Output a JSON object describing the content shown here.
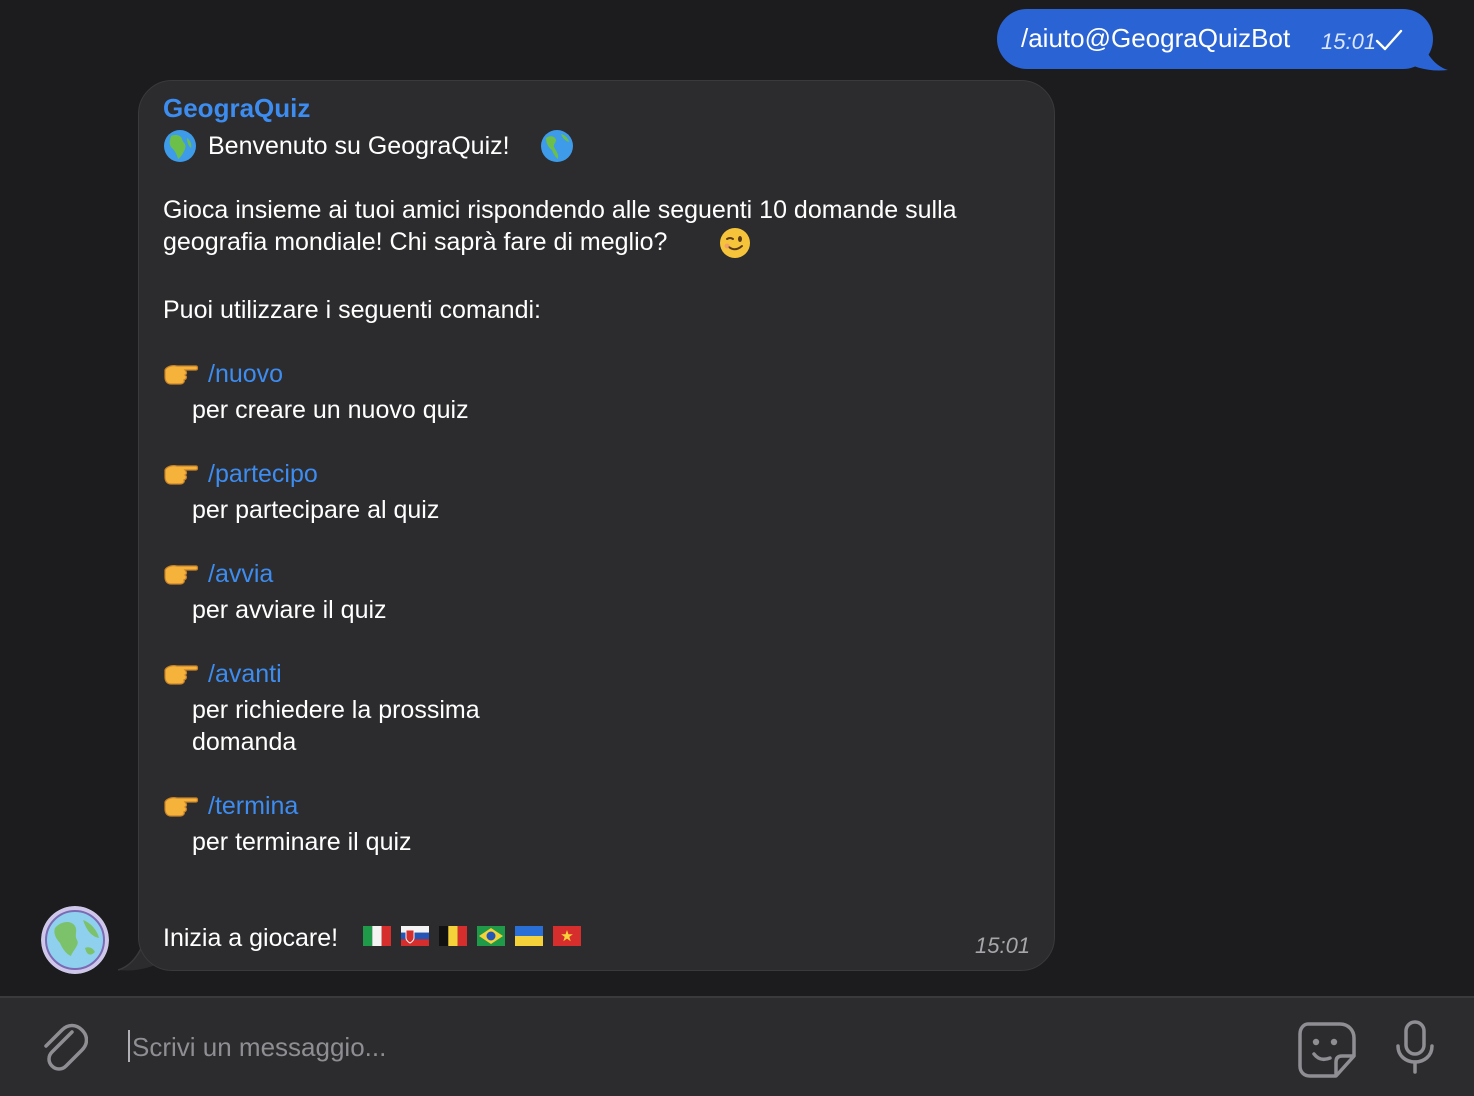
{
  "outgoing": {
    "text": "/aiuto@GeograQuizBot",
    "time": "15:01",
    "status_icon": "checkmark-icon",
    "bubble_color": "#2a63d4"
  },
  "incoming": {
    "sender": "GeograQuiz",
    "welcome_text": "Benvenuto su GeograQuiz!",
    "intro_line1": "Gioca insieme ai tuoi amici rispondendo alle seguenti 10 domande sulla",
    "intro_line2": "geografia mondiale! Chi saprà fare di meglio?",
    "commands_header": "Puoi utilizzare i seguenti comandi:",
    "commands": [
      {
        "command": "/nuovo",
        "description": "per creare un nuovo quiz"
      },
      {
        "command": "/partecipo",
        "description": "per partecipare al quiz"
      },
      {
        "command": "/avvia",
        "description": "per avviare il quiz"
      },
      {
        "command": "/avanti",
        "description": "per richiedere la prossima",
        "description2": "domanda"
      },
      {
        "command": "/termina",
        "description": "per terminare il quiz"
      }
    ],
    "footer_text": "Inizia a giocare!",
    "flags": [
      "italy-flag",
      "slovakia-flag",
      "belgium-flag",
      "brazil-flag",
      "ukraine-flag",
      "vietnam-flag"
    ],
    "time": "15:01",
    "link_color": "#3d8cf0"
  },
  "input": {
    "placeholder": "Scrivi un messaggio..."
  }
}
